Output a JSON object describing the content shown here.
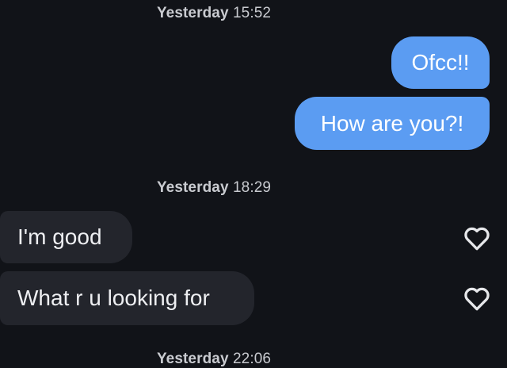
{
  "conversation": {
    "groups": [
      {
        "timestamp": {
          "day": "Yesterday",
          "time": "15:52"
        },
        "messages": [
          {
            "direction": "sent",
            "text": "Ofcc!!"
          },
          {
            "direction": "sent",
            "text": "How are you?!"
          }
        ]
      },
      {
        "timestamp": {
          "day": "Yesterday",
          "time": "18:29"
        },
        "messages": [
          {
            "direction": "received",
            "text": "I'm good",
            "like_icon": "heart-outline-icon"
          },
          {
            "direction": "received",
            "text": "What r u looking for",
            "like_icon": "heart-outline-icon"
          }
        ]
      },
      {
        "timestamp": {
          "day": "Yesterday",
          "time": "22:06"
        },
        "messages": []
      }
    ]
  },
  "colors": {
    "background": "#111318",
    "sent_bubble": "#5b9cf2",
    "received_bubble": "#23252c",
    "timestamp_text": "#c9cbd0",
    "heart_stroke": "#e6e7ea"
  }
}
